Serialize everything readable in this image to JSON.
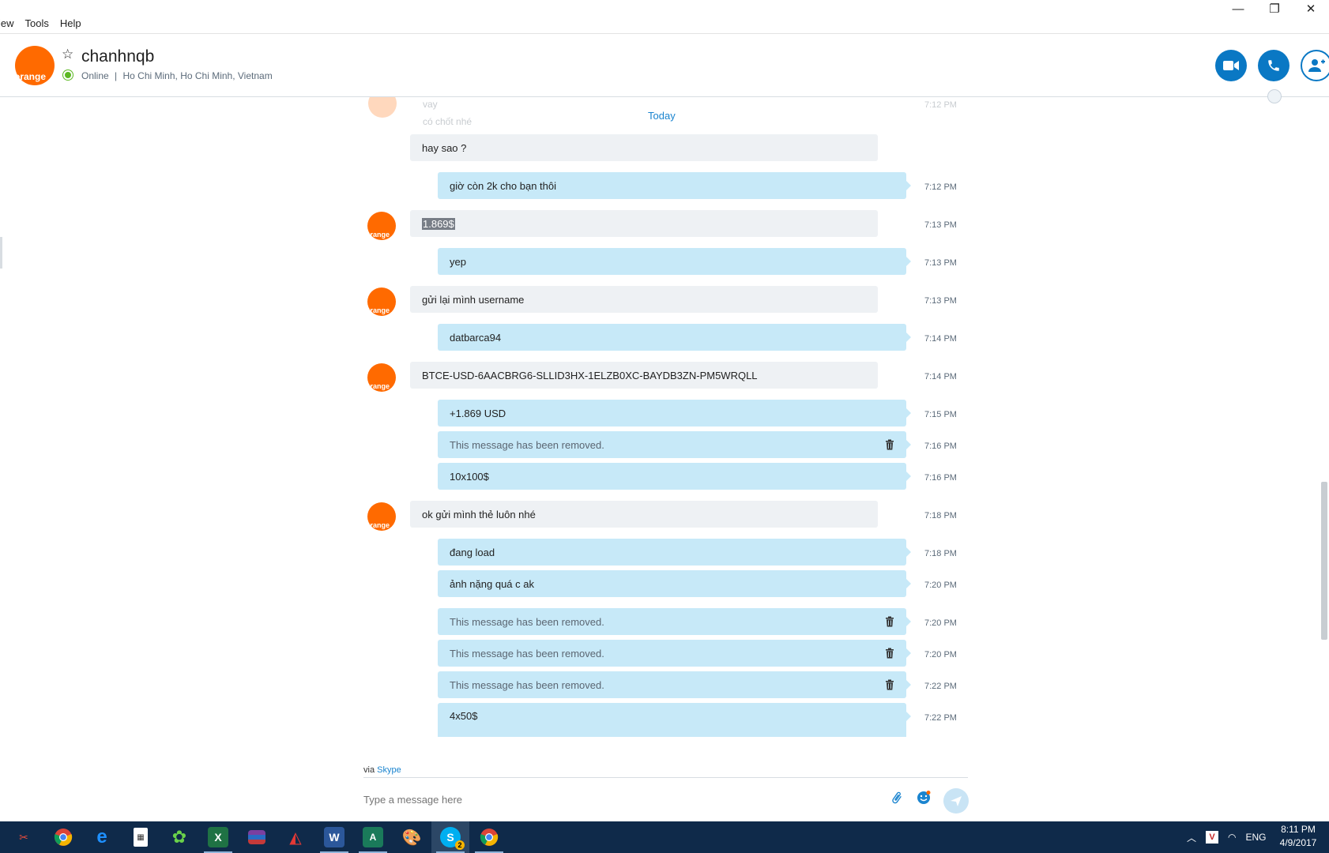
{
  "menu": {
    "view": "iew",
    "tools": "Tools",
    "help": "Help"
  },
  "window_controls": {
    "minimize": "—",
    "restore": "❐",
    "close": "✕"
  },
  "contact": {
    "avatar_text": "orange",
    "name": "chanhnqb",
    "status": "Online",
    "separator": "|",
    "location": "Ho Chi Minh, Ho Chi Minh, Vietnam"
  },
  "conversation": {
    "date_divider": "Today",
    "faded_lines": [
      "vay",
      "có chốt nhé"
    ],
    "faded_time": "7:12 PM",
    "messages": [
      {
        "dir": "in",
        "text": "hay sao ?",
        "time": ""
      },
      {
        "dir": "out",
        "text": "giờ còn 2k cho bạn thôi",
        "time": "7:12 PM"
      },
      {
        "dir": "in",
        "text": "1.869$",
        "time": "7:13 PM"
      },
      {
        "dir": "out",
        "text": "yep",
        "time": "7:13 PM"
      },
      {
        "dir": "in",
        "text": "gửi lại mình username",
        "time": "7:13 PM"
      },
      {
        "dir": "out",
        "text": "datbarca94",
        "time": "7:14 PM"
      },
      {
        "dir": "in",
        "text": "BTCE-USD-6AACBRG6-SLLID3HX-1ELZB0XC-BAYDB3ZN-PM5WRQLL",
        "time": "7:14 PM"
      },
      {
        "dir": "out",
        "text": "+1.869 USD",
        "time": "7:15 PM"
      },
      {
        "dir": "out",
        "text": "This message has been removed.",
        "time": "7:16 PM"
      },
      {
        "dir": "out",
        "text": "10x100$",
        "time": "7:16 PM"
      },
      {
        "dir": "in",
        "text": "ok gửi mình thẻ luôn nhé",
        "time": "7:18 PM"
      },
      {
        "dir": "out",
        "text": "đang load",
        "time": "7:18 PM"
      },
      {
        "dir": "out",
        "text": "ảnh nặng quá c ak",
        "time": "7:20 PM"
      },
      {
        "dir": "out",
        "text": "This message has been removed.",
        "time": "7:20 PM"
      },
      {
        "dir": "out",
        "text": "This message has been removed.",
        "time": "7:20 PM"
      },
      {
        "dir": "out",
        "text": "This message has been removed.",
        "time": "7:22 PM"
      },
      {
        "dir": "out",
        "text": "4x50$",
        "time": "7:22 PM"
      }
    ]
  },
  "compose": {
    "via_prefix": "via",
    "via_link": "Skype",
    "placeholder": "Type a message here"
  },
  "taskbar": {
    "apps": [
      "snipping-tool",
      "chrome",
      "edge",
      "calculator",
      "game",
      "excel",
      "winrar",
      "foxit",
      "word",
      "font-tool",
      "paint",
      "skype",
      "chrome-profile"
    ],
    "skype_badge": "2",
    "language": "ENG",
    "time": "8:11 PM",
    "date": "4/9/2017"
  },
  "colors": {
    "accent": "#0a78c4",
    "outgoing_bubble": "#c7e9f8",
    "incoming_bubble": "#eef1f4",
    "avatar": "#ff6a00",
    "online": "#5cb822",
    "taskbar": "#0f2a4a"
  }
}
